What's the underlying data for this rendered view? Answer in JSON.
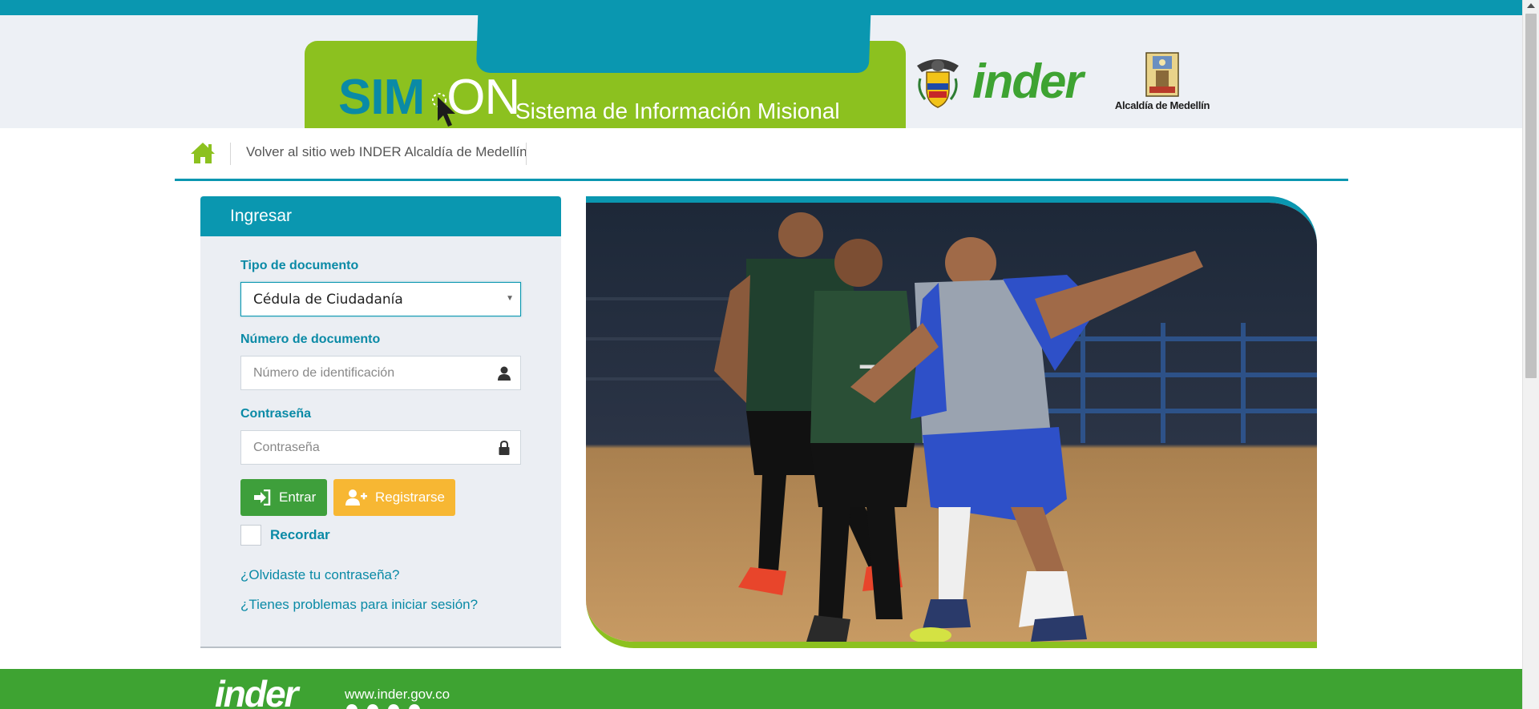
{
  "header": {
    "logo_prefix": "SIM",
    "logo_suffix": "ON",
    "subtitle": "Sistema de Información Misional",
    "partner_inder": "inder",
    "partner_alcaldia": "Alcaldía de Medellín"
  },
  "nav": {
    "home_icon": "home-icon",
    "back_link": "Volver al sitio web INDER Alcaldía de Medellín"
  },
  "login": {
    "title": "Ingresar",
    "doc_type_label": "Tipo de documento",
    "doc_type_value": "Cédula de Ciudadanía",
    "doc_number_label": "Número de documento",
    "doc_number_placeholder": "Número de identificación",
    "password_label": "Contraseña",
    "password_placeholder": "Contraseña",
    "enter_button": "Entrar",
    "register_button": "Registrarse",
    "remember_label": "Recordar",
    "forgot_link": "¿Olvidaste tu contraseña?",
    "trouble_link": "¿Tienes problemas para iniciar sesión?"
  },
  "footer": {
    "logo": "inder",
    "url": "www.inder.gov.co"
  },
  "colors": {
    "teal": "#0a97b0",
    "lime": "#8cc11f",
    "green": "#3ea332",
    "orange": "#f7b733"
  }
}
